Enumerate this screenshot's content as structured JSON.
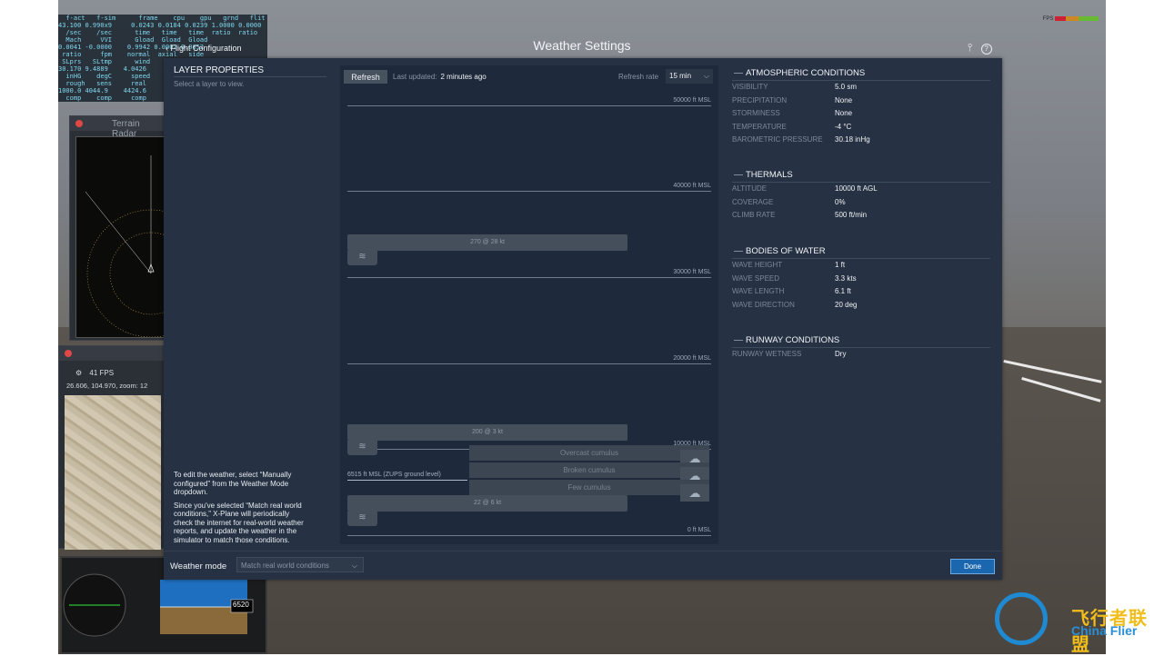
{
  "sim_background": {
    "data_output_rows": [
      "  f-act   f-sim      frame    cpu    gpu   grnd   flit",
      "43.100 0.990x9     0.0243 0.0184 0.0239 1.0000 0.0000",
      "  /sec    /sec      time   time   time  ratio  ratio",
      "  Mach     VVI      Gload  Gload  Gload",
      "0.0041 -0.0000    0.9942 0.0002 0.0052",
      " ratio     fpm    normal  axial   side",
      " SLprs   SLtmp      wind",
      "30.170 9.4889    4.0426",
      "  inHG    degC     speed",
      "  rough   sens     real",
      "1000.0 4044.9    4424.6",
      "  comp    comp     comp"
    ],
    "terrain_radar_title": "Terrain Radar",
    "map_fps": "41 FPS",
    "map_coords": "26.606, 104.970, zoom: 12",
    "panel_readout": "6520",
    "fps_indicator": "FPS",
    "logo_cn": "飞行者联盟",
    "logo_en": "China Flier"
  },
  "dialog": {
    "title": "Weather Settings",
    "back_label": "Flight Configuration",
    "settings_icon": "sliders-icon",
    "help_icon": "help-icon"
  },
  "left": {
    "layer_title": "LAYER PROPERTIES",
    "layer_hint": "Select a layer to view.",
    "edit_note_1": "To edit the weather, select “Manually configured” from the Weather Mode dropdown.",
    "edit_note_2": "Since you've selected “Match real world conditions,” X-Plane will periodically check the internet for real-world weather reports, and update the weather in the simulator to match those conditions."
  },
  "center": {
    "refresh_label": "Refresh",
    "last_updated_label": "Last updated:",
    "last_updated_value": "2 minutes ago",
    "refresh_rate_label": "Refresh rate",
    "refresh_rate_value": "15 min",
    "altitudes": [
      "50000 ft MSL",
      "40000 ft MSL",
      "30000 ft MSL",
      "20000 ft MSL",
      "10000 ft MSL",
      "0 ft MSL"
    ],
    "ground_level": "6515 ft MSL (ZUPS ground level)",
    "wind_layers": [
      "270 @ 28 kt",
      "200 @ 3 kt",
      "22 @ 6 kt"
    ],
    "cloud_layers": [
      "Overcast cumulus",
      "Broken cumulus",
      "Few cumulus"
    ]
  },
  "atmospheric": {
    "title": "ATMOSPHERIC CONDITIONS",
    "rows": [
      {
        "k": "VISIBILITY",
        "v": "5.0 sm"
      },
      {
        "k": "PRECIPITATION",
        "v": "None"
      },
      {
        "k": "STORMINESS",
        "v": "None"
      },
      {
        "k": "TEMPERATURE",
        "v": "-4 °C"
      },
      {
        "k": "BAROMETRIC PRESSURE",
        "v": "30.18 inHg"
      }
    ]
  },
  "thermals": {
    "title": "THERMALS",
    "rows": [
      {
        "k": "ALTITUDE",
        "v": "10000 ft AGL"
      },
      {
        "k": "COVERAGE",
        "v": "0%"
      },
      {
        "k": "CLIMB RATE",
        "v": "500 ft/min"
      }
    ]
  },
  "water": {
    "title": "BODIES OF WATER",
    "rows": [
      {
        "k": "WAVE HEIGHT",
        "v": "1 ft"
      },
      {
        "k": "WAVE SPEED",
        "v": "3.3 kts"
      },
      {
        "k": "WAVE LENGTH",
        "v": "6.1 ft"
      },
      {
        "k": "WAVE DIRECTION",
        "v": "20 deg"
      }
    ]
  },
  "runway": {
    "title": "RUNWAY CONDITIONS",
    "rows": [
      {
        "k": "RUNWAY WETNESS",
        "v": "Dry"
      }
    ]
  },
  "bottom": {
    "weather_mode_label": "Weather mode",
    "weather_mode_value": "Match real world conditions",
    "done_label": "Done"
  },
  "colors": {
    "dialog_bg": "#263243",
    "panel_bg": "#1e2a3b",
    "done_accent": "#1a67b0"
  }
}
